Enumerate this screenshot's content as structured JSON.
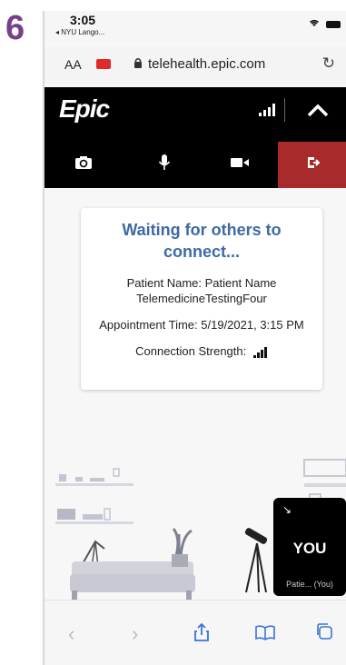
{
  "step_label": "6",
  "status_bar": {
    "time": "3:05",
    "back_app": "◂ NYU Lango..."
  },
  "browser": {
    "text_size": "AA",
    "domain": "telehealth.epic.com",
    "reload_glyph": "↻"
  },
  "header": {
    "logo": "Epic"
  },
  "waiting_card": {
    "title": "Waiting for others to connect...",
    "patient_name": "Patient Name: Patient Name TelemedicineTestingFour",
    "appointment_time": "Appointment Time: 5/19/2021, 3:15 PM",
    "connection_strength": "Connection Strength:"
  },
  "self_view": {
    "label": "YOU",
    "name": "Patie... (You)"
  },
  "toolbar": {
    "back": "‹",
    "forward": "›",
    "share": "⇧",
    "bookmarks": "🕮",
    "tabs": "❐"
  },
  "colors": {
    "accent": "#3d6aa3",
    "end_call": "#a82a2a",
    "header_bg": "#000000",
    "step": "#7a3f8c"
  }
}
